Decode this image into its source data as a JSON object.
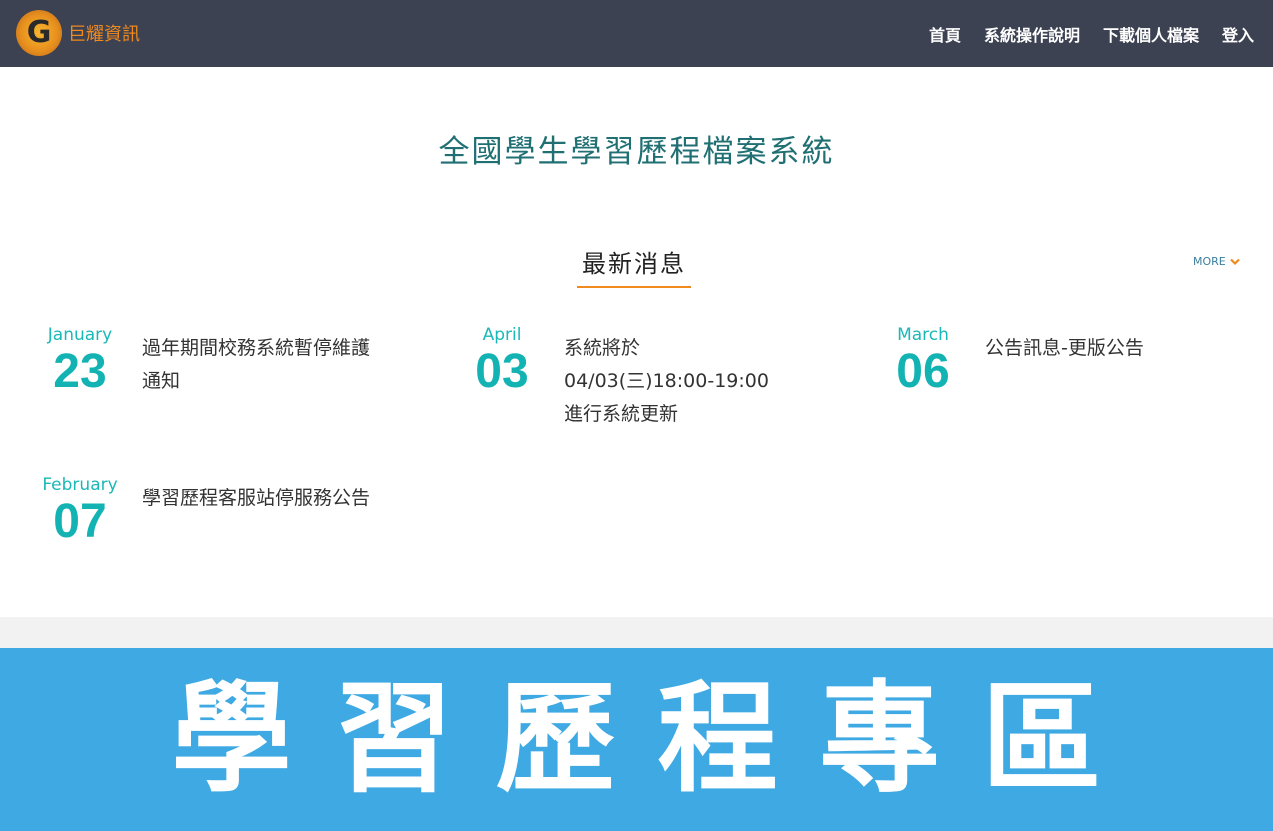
{
  "brand": {
    "logo_letter": "G",
    "name": "巨耀資訊"
  },
  "nav": {
    "items": [
      {
        "label": "首頁"
      },
      {
        "label": "系統操作說明"
      },
      {
        "label": "下載個人檔案"
      },
      {
        "label": "登入"
      }
    ]
  },
  "site_title": "全國學生學習歷程檔案系統",
  "news": {
    "heading": "最新消息",
    "more_label": "MORE",
    "items": [
      {
        "month": "January",
        "day": "23",
        "title": "過年期間校務系統暫停維護通知"
      },
      {
        "month": "April",
        "day": "03",
        "title": "系統將於04/03(三)18:00-19:00 進行系統更新"
      },
      {
        "month": "March",
        "day": "06",
        "title": "公告訊息-更版公告"
      },
      {
        "month": "February",
        "day": "07",
        "title": "學習歷程客服站停服務公告"
      }
    ]
  },
  "banner": {
    "text": "學習歷程專區"
  },
  "colors": {
    "navbar": "#3d4253",
    "accent_orange": "#f08a1c",
    "teal": "#14b3b3",
    "banner": "#3ea9e3"
  }
}
